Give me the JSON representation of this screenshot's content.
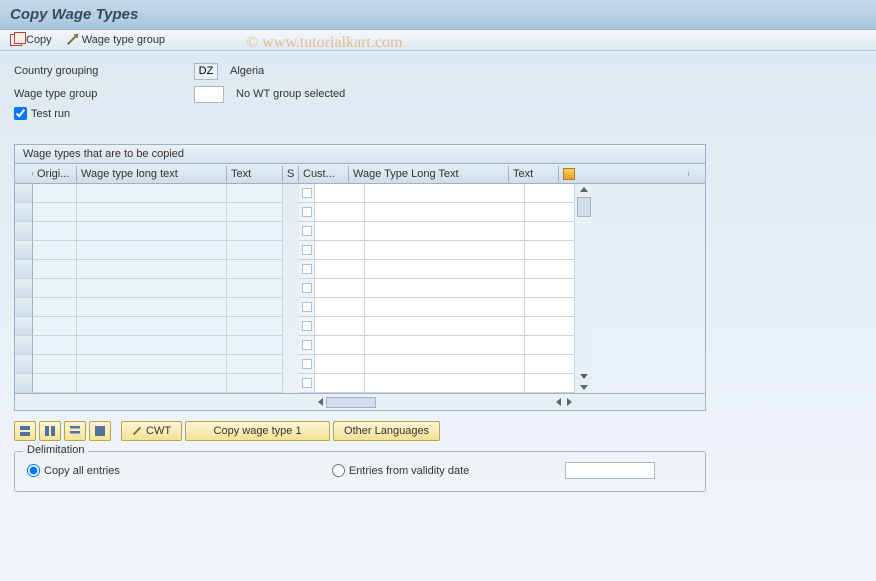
{
  "title": "Copy Wage Types",
  "toolbar": {
    "copy_label": "Copy",
    "wtg_label": "Wage type group"
  },
  "form": {
    "country_grouping_label": "Country grouping",
    "country_grouping_value": "DZ",
    "country_grouping_desc": "Algeria",
    "wage_type_group_label": "Wage type group",
    "wage_type_group_value": "",
    "wage_type_group_desc": "No WT group selected",
    "test_run_label": "Test run",
    "test_run_checked": true
  },
  "table": {
    "title": "Wage types that are to be copied",
    "headers": {
      "origi": "Origi...",
      "wtlt": "Wage type long text",
      "text": "Text",
      "s": "S",
      "cust": "Cust...",
      "wtlt2": "Wage Type Long Text",
      "text2": "Text"
    },
    "row_count": 11
  },
  "buttons": {
    "cwt": "CWT",
    "copy_wt1": "Copy wage type 1",
    "other_lang": "Other Languages"
  },
  "delimitation": {
    "title": "Delimitation",
    "copy_all_label": "Copy all entries",
    "entries_from_label": "Entries from validity date",
    "date_value": "",
    "selected": "copy_all"
  },
  "watermark": "© www.tutorialkart.com"
}
